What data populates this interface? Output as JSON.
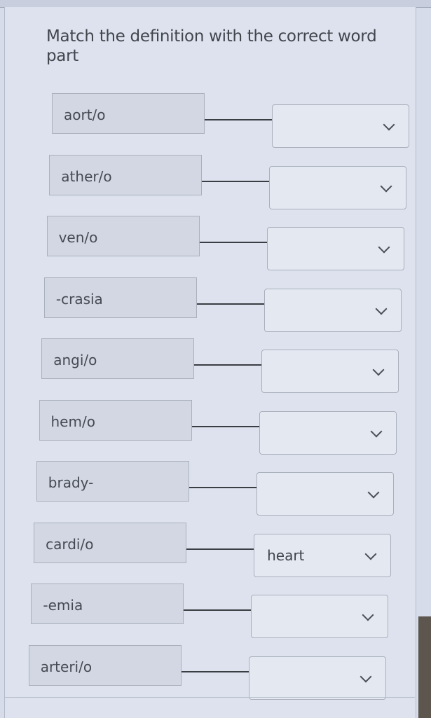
{
  "question": {
    "title": "Match the deﬁnition with the correct word part"
  },
  "rows": [
    {
      "term": "aort/o",
      "selected": ""
    },
    {
      "term": "ather/o",
      "selected": ""
    },
    {
      "term": "ven/o",
      "selected": ""
    },
    {
      "term": "-crasia",
      "selected": ""
    },
    {
      "term": "angi/o",
      "selected": ""
    },
    {
      "term": "hem/o",
      "selected": ""
    },
    {
      "term": "brady-",
      "selected": ""
    },
    {
      "term": "cardi/o",
      "selected": "heart"
    },
    {
      "term": "-emia",
      "selected": ""
    },
    {
      "term": "arteri/o",
      "selected": ""
    }
  ],
  "icons": {
    "dropdown": "chevron-down-icon"
  }
}
